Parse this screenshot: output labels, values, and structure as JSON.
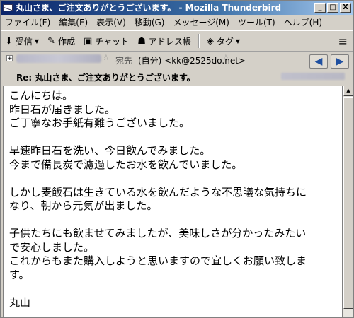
{
  "window": {
    "title": "丸山さま、ご注文ありがとうございます。 - Mozilla Thunderbird",
    "minimize": "_",
    "maximize": "□",
    "close": "X"
  },
  "menubar": {
    "items": [
      "ファイル(F)",
      "編集(E)",
      "表示(V)",
      "移動(G)",
      "メッセージ(M)",
      "ツール(T)",
      "ヘルプ(H)"
    ]
  },
  "toolbar": {
    "receive": "受信",
    "compose": "作成",
    "chat": "チャット",
    "addressbook": "アドレス帳",
    "tag": "タグ"
  },
  "header": {
    "toggle": "+",
    "to_label": "宛先",
    "to_value": "(自分) <kk@2525do.net>",
    "subject": "Re: 丸山さま、ご注文ありがとうございます。",
    "back": "◀",
    "forward": "▶"
  },
  "message": {
    "lines": [
      "こんにちは。",
      "昨日石が届きました。",
      "ご丁寧なお手紙有難うございました。",
      "",
      "早速昨日石を洗い、今日飲んでみました。",
      "今まで備長炭で濾過したお水を飲んでいました。",
      "",
      "しかし麦飯石は生きている水を飲んだような不思議な気持ちに",
      "なり、朝から元気が出ました。",
      "",
      "子供たちにも飲ませてみましたが、美味しさが分かったみたい",
      "で安心しました。",
      "これからもまた購入しようと思いますので宜しくお願い致しま",
      "す。",
      "",
      "丸山"
    ]
  }
}
